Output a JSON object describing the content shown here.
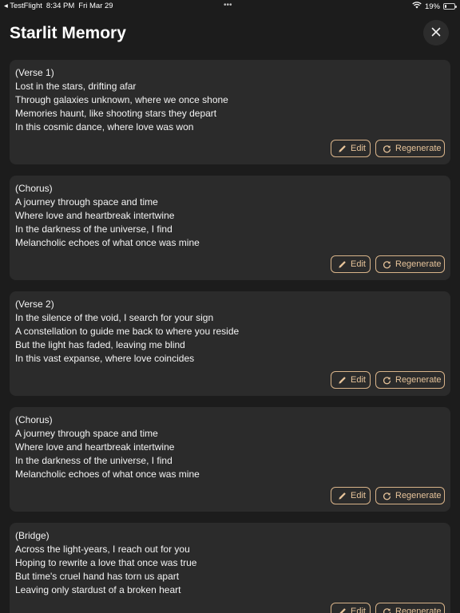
{
  "status_bar": {
    "back_app": "◂ TestFlight",
    "time": "8:34 PM",
    "date": "Fri Mar 29",
    "dots": "•••",
    "battery_percent": "19%",
    "battery_level": 0.19
  },
  "header": {
    "title": "Starlit Memory",
    "close_glyph": "✕"
  },
  "actions": {
    "edit_label": "Edit",
    "regenerate_label": "Regenerate"
  },
  "sections": [
    {
      "lines": [
        "(Verse 1)",
        "Lost in the stars, drifting afar",
        "Through galaxies unknown, where we once shone",
        "Memories haunt, like shooting stars they depart",
        "In this cosmic dance, where love was won"
      ]
    },
    {
      "lines": [
        "(Chorus)",
        "A journey through space and time",
        "Where love and heartbreak intertwine",
        "In the darkness of the universe, I find",
        "Melancholic echoes of what once was mine"
      ]
    },
    {
      "lines": [
        "(Verse 2)",
        "In the silence of the void, I search for your sign",
        "A constellation to guide me back to where you reside",
        "But the light has faded, leaving me blind",
        "In this vast expanse, where love coincides"
      ]
    },
    {
      "lines": [
        "(Chorus)",
        "A journey through space and time",
        "Where love and heartbreak intertwine",
        "In the darkness of the universe, I find",
        "Melancholic echoes of what once was mine"
      ]
    },
    {
      "lines": [
        "(Bridge)",
        "Across the light-years, I reach out for you",
        "Hoping to rewrite a love that once was true",
        "But time's cruel hand has torn us apart",
        "Leaving only stardust of a broken heart"
      ]
    }
  ],
  "colors": {
    "background": "#1c1c1c",
    "card": "#2b2b2b",
    "accent": "#e6c39a"
  },
  "icons": {
    "edit": "pencil-icon",
    "regenerate": "refresh-icon",
    "close": "close-icon",
    "wifi": "wifi-icon",
    "battery": "battery-icon"
  }
}
